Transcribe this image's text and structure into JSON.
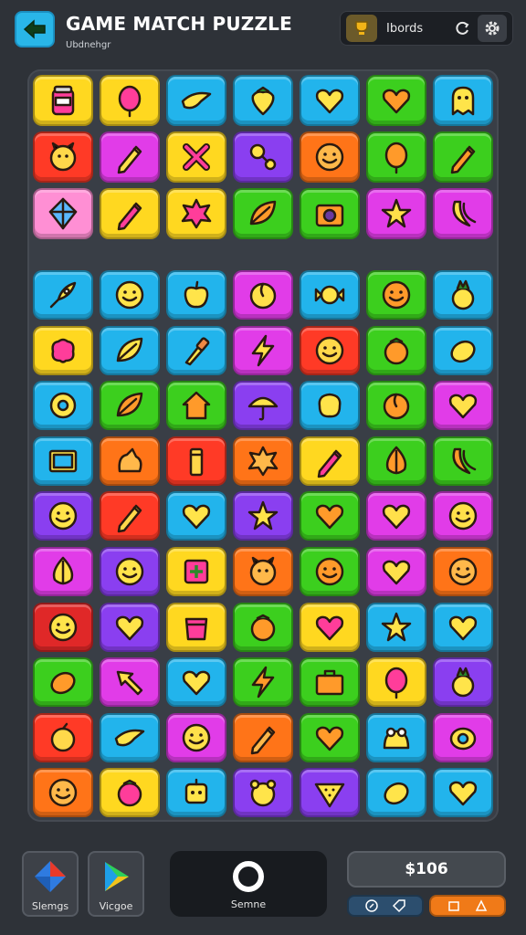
{
  "header": {
    "title": "GAME MATCH PUZZLE",
    "subtitle": "Ubdnehgr",
    "label": "Ibords"
  },
  "palette": {
    "yellow": "#ffe01c",
    "pink": "#ff4fd8",
    "blue": "#29b6f0",
    "red": "#ff3d2e",
    "green": "#3fd020",
    "orange": "#ff7a18",
    "purple": "#8a3ff0",
    "lightpink": "#ff8fd4",
    "magenta": "#e23fe8",
    "crimson": "#e42a2a"
  },
  "board_top": [
    [
      [
        "yellow",
        "jar-icon"
      ],
      [
        "yellow",
        "balloon-icon"
      ],
      [
        "blue",
        "bird-icon"
      ],
      [
        "blue",
        "strawberry-icon"
      ],
      [
        "blue",
        "heart-icon"
      ],
      [
        "green",
        "heart-icon"
      ],
      [
        "blue",
        "ghost-icon"
      ]
    ],
    [
      [
        "red",
        "creature-icon"
      ],
      [
        "magenta",
        "pencil-icon"
      ],
      [
        "yellow",
        "cross-icon"
      ],
      [
        "purple",
        "rattle-icon"
      ],
      [
        "orange",
        "smiley-icon"
      ],
      [
        "green",
        "balloon-icon"
      ],
      [
        "green",
        "pencil-icon"
      ]
    ],
    [
      [
        "lightpink",
        "kite-icon"
      ],
      [
        "yellow",
        "pencil-icon"
      ],
      [
        "yellow",
        "splat-icon"
      ],
      [
        "green",
        "leaf-icon"
      ],
      [
        "green",
        "camera-icon"
      ],
      [
        "magenta",
        "star-icon"
      ],
      [
        "magenta",
        "banana-icon"
      ]
    ]
  ],
  "board_bottom": [
    [
      [
        "blue",
        "rocket-icon"
      ],
      [
        "blue",
        "smiley-icon"
      ],
      [
        "blue",
        "apple-icon"
      ],
      [
        "magenta",
        "peach-icon"
      ],
      [
        "blue",
        "candy-icon"
      ],
      [
        "green",
        "smiley-icon"
      ],
      [
        "blue",
        "pineapple-icon"
      ]
    ],
    [
      [
        "yellow",
        "brain-icon"
      ],
      [
        "blue",
        "leaf-icon"
      ],
      [
        "blue",
        "brush-icon"
      ],
      [
        "magenta",
        "bolt-icon"
      ],
      [
        "red",
        "smiley-icon"
      ],
      [
        "green",
        "tomato-icon"
      ],
      [
        "blue",
        "lemon-icon"
      ]
    ],
    [
      [
        "blue",
        "donut-icon"
      ],
      [
        "green",
        "leaf-icon"
      ],
      [
        "green",
        "house-icon"
      ],
      [
        "purple",
        "umbrella-icon"
      ],
      [
        "blue",
        "blob-icon"
      ],
      [
        "green",
        "peach-icon"
      ],
      [
        "magenta",
        "heart-icon"
      ]
    ],
    [
      [
        "blue",
        "tv-icon"
      ],
      [
        "orange",
        "dog-icon"
      ],
      [
        "red",
        "crayon-icon"
      ],
      [
        "orange",
        "splat-icon"
      ],
      [
        "yellow",
        "pencil-icon"
      ],
      [
        "green",
        "onion-icon"
      ],
      [
        "green",
        "banana-icon"
      ]
    ],
    [
      [
        "purple",
        "smiley-icon"
      ],
      [
        "red",
        "pencil-icon"
      ],
      [
        "blue",
        "heart-icon"
      ],
      [
        "purple",
        "star-icon"
      ],
      [
        "green",
        "heart-icon"
      ],
      [
        "magenta",
        "heart-icon"
      ],
      [
        "magenta",
        "smiley-icon"
      ]
    ],
    [
      [
        "magenta",
        "onion-icon"
      ],
      [
        "purple",
        "smiley-icon"
      ],
      [
        "yellow",
        "plus-icon"
      ],
      [
        "orange",
        "creature-icon"
      ],
      [
        "green",
        "smiley-icon"
      ],
      [
        "magenta",
        "heart-icon"
      ],
      [
        "orange",
        "smiley-icon"
      ]
    ],
    [
      [
        "crimson",
        "smiley-icon"
      ],
      [
        "purple",
        "heart-icon"
      ],
      [
        "yellow",
        "box-icon"
      ],
      [
        "green",
        "tomato-icon"
      ],
      [
        "yellow",
        "heart-icon"
      ],
      [
        "blue",
        "star-icon"
      ],
      [
        "blue",
        "heart-icon"
      ]
    ],
    [
      [
        "green",
        "lemon-icon"
      ],
      [
        "magenta",
        "arrow-icon"
      ],
      [
        "blue",
        "heart-icon"
      ],
      [
        "green",
        "bolt-icon"
      ],
      [
        "green",
        "briefcase-icon"
      ],
      [
        "yellow",
        "balloon-icon"
      ],
      [
        "purple",
        "pineapple-icon"
      ]
    ],
    [
      [
        "red",
        "plum-icon"
      ],
      [
        "blue",
        "bird-icon"
      ],
      [
        "magenta",
        "smiley-icon"
      ],
      [
        "orange",
        "pencil-icon"
      ],
      [
        "green",
        "heart-icon"
      ],
      [
        "blue",
        "frog-icon"
      ],
      [
        "magenta",
        "bug-icon"
      ]
    ],
    [
      [
        "orange",
        "smiley-icon"
      ],
      [
        "yellow",
        "tomato-icon"
      ],
      [
        "blue",
        "robot-icon"
      ],
      [
        "purple",
        "bear-icon"
      ],
      [
        "purple",
        "watermelon-icon"
      ],
      [
        "blue",
        "lemon-icon"
      ],
      [
        "blue",
        "heart-icon"
      ]
    ]
  ],
  "footer": {
    "left1_label": "Slemgs",
    "left2_label": "Vicgoe",
    "center_label": "Semne",
    "score": "$106"
  }
}
